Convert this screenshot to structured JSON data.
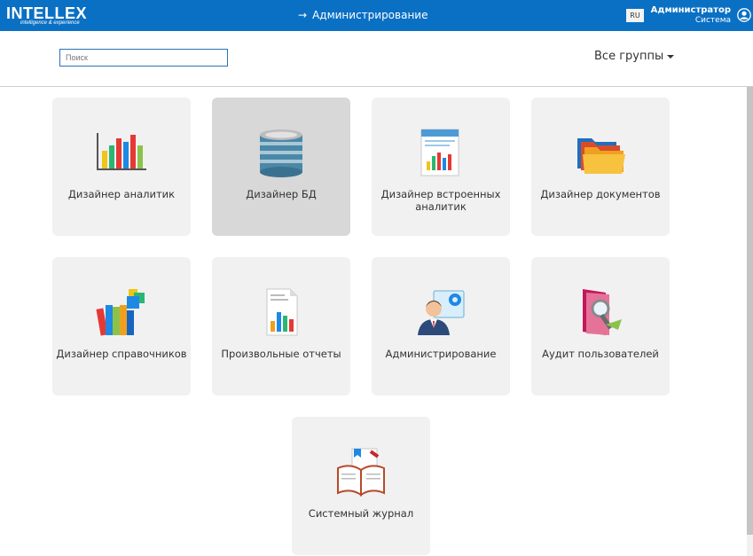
{
  "header": {
    "logo_text": "INTELLEX",
    "logo_tagline": "intelligence & experience",
    "breadcrumb_arrow": "→",
    "breadcrumb": "Администрирование",
    "lang": "RU",
    "user_name": "Администратор",
    "user_sub": "Система"
  },
  "toolbar": {
    "search_placeholder": "Поиск",
    "groups_label": "Все группы"
  },
  "tiles": [
    {
      "label": "Дизайнер аналитик",
      "icon": "analytics-chart-icon"
    },
    {
      "label": "Дизайнер БД",
      "icon": "database-icon",
      "active": true
    },
    {
      "label": "Дизайнер встроенных аналитик",
      "icon": "embedded-report-icon"
    },
    {
      "label": "Дизайнер документов",
      "icon": "folders-icon"
    },
    {
      "label": "Дизайнер справочников",
      "icon": "books-icon"
    },
    {
      "label": "Произвольные отчеты",
      "icon": "report-document-icon"
    },
    {
      "label": "Администрирование",
      "icon": "admin-user-gear-icon"
    },
    {
      "label": "Аудит пользователей",
      "icon": "audit-folder-magnifier-icon"
    },
    {
      "label": "Системный журнал",
      "icon": "journal-book-icon"
    }
  ]
}
